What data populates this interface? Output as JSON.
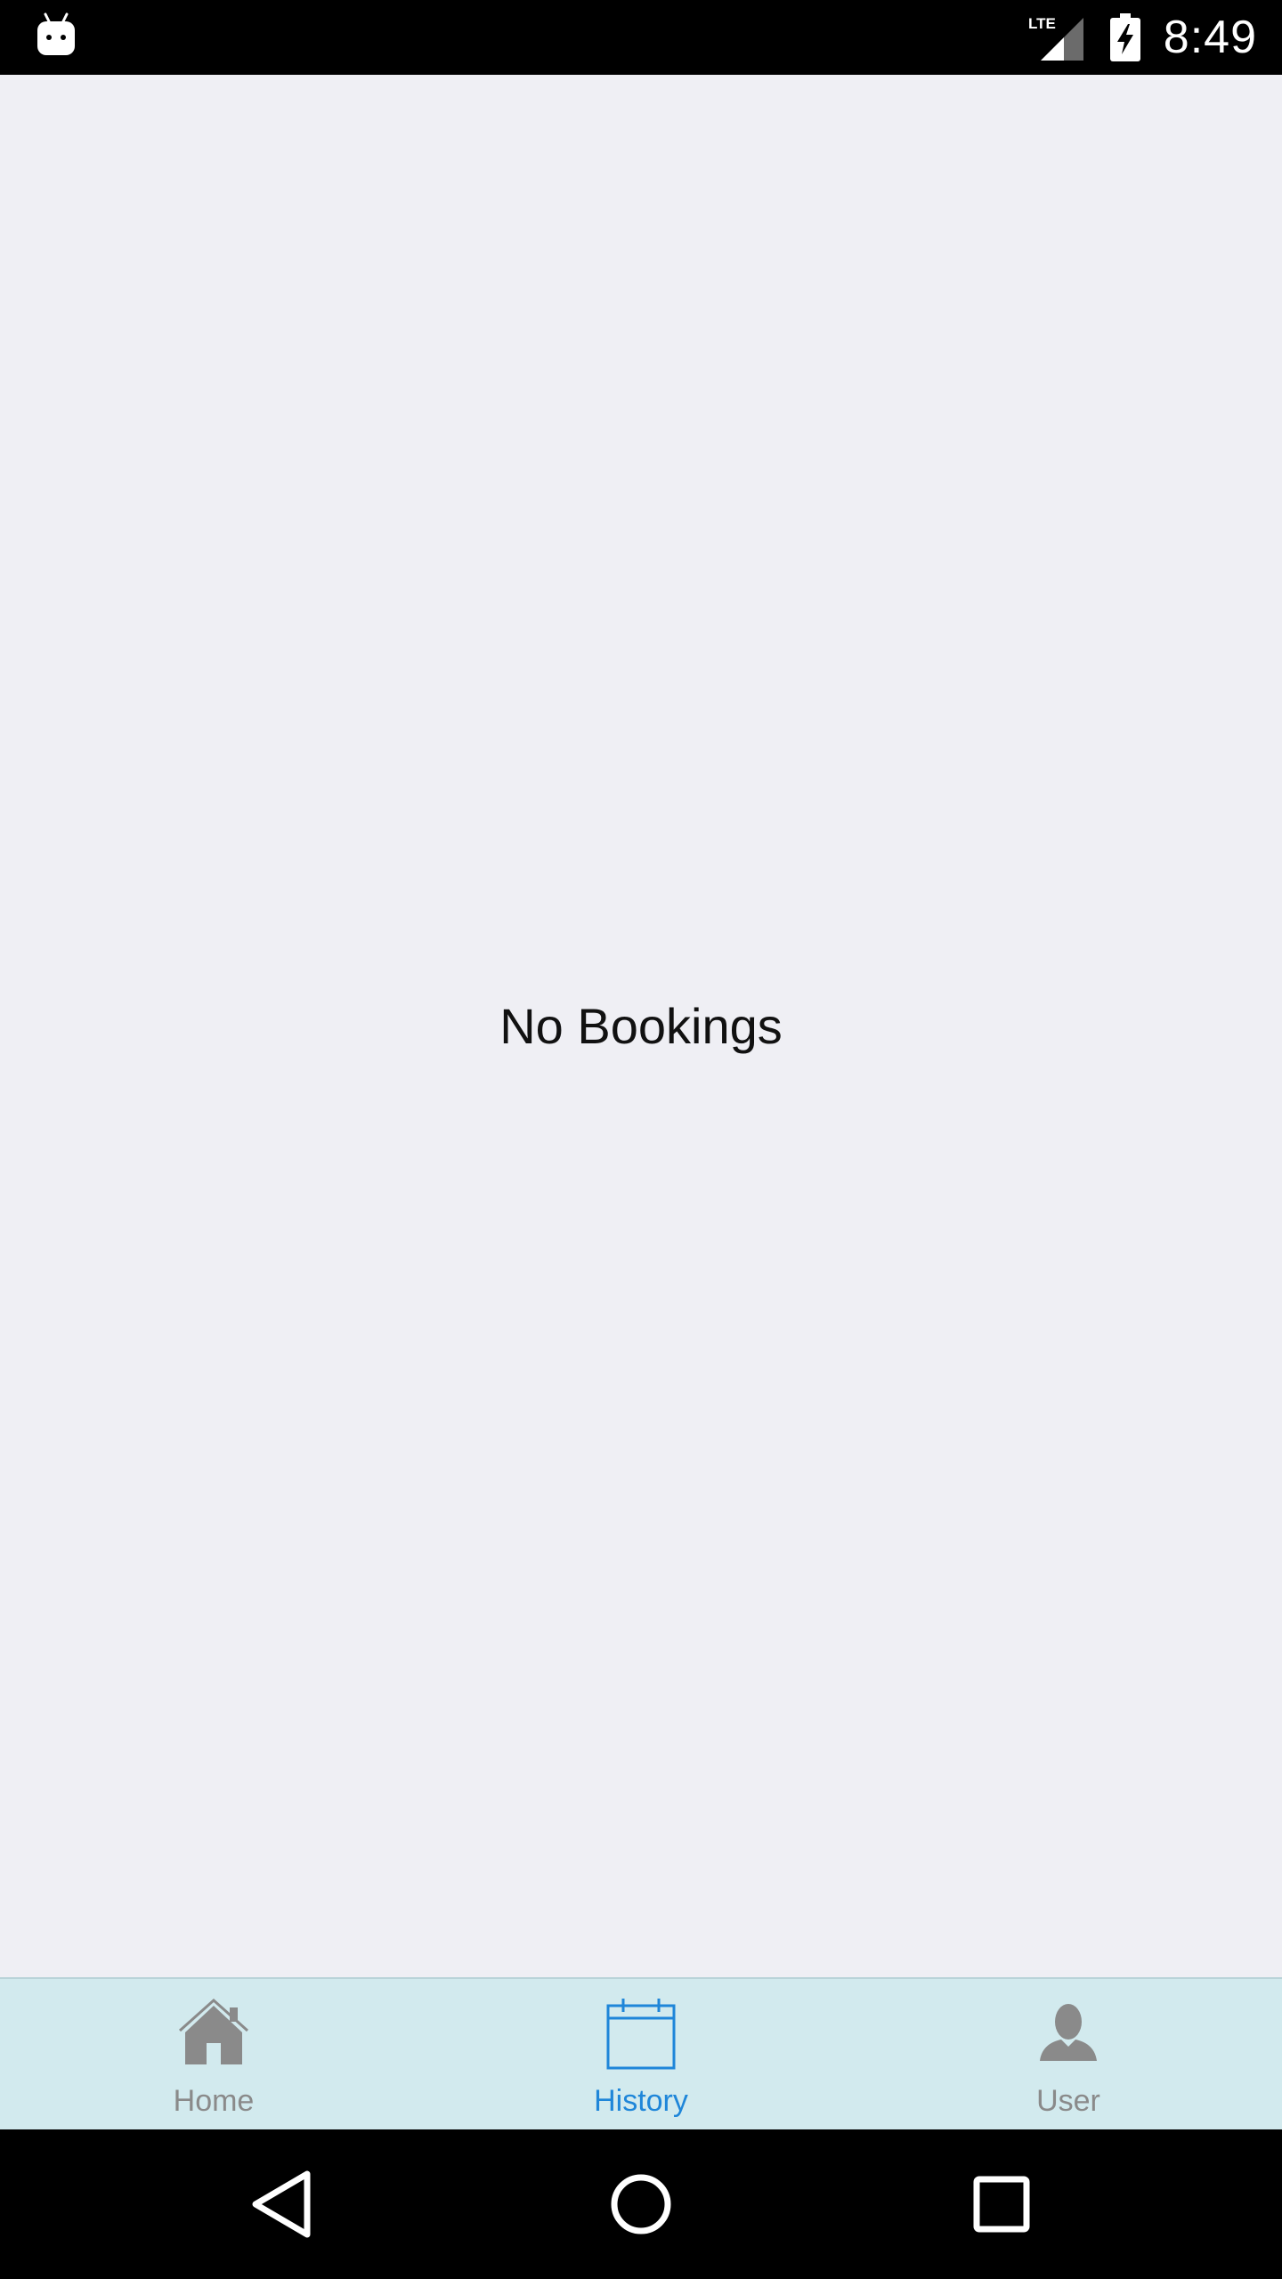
{
  "status_bar": {
    "network": "LTE",
    "time": "8:49",
    "icons": [
      "android-notification-icon",
      "lte-signal-icon",
      "battery-charging-icon"
    ]
  },
  "main": {
    "empty_message": "No Bookings"
  },
  "tabs": [
    {
      "label": "Home",
      "icon": "home-icon",
      "active": false
    },
    {
      "label": "History",
      "icon": "calendar-icon",
      "active": true
    },
    {
      "label": "User",
      "icon": "user-icon",
      "active": false
    }
  ],
  "colors": {
    "background": "#efeff4",
    "tab_bar": "#d2eaee",
    "active_tab": "#1f86d9",
    "inactive_tab": "#8a8a8a"
  },
  "nav_bar": {
    "buttons": [
      "back-icon",
      "home-circle-icon",
      "recents-icon"
    ]
  }
}
